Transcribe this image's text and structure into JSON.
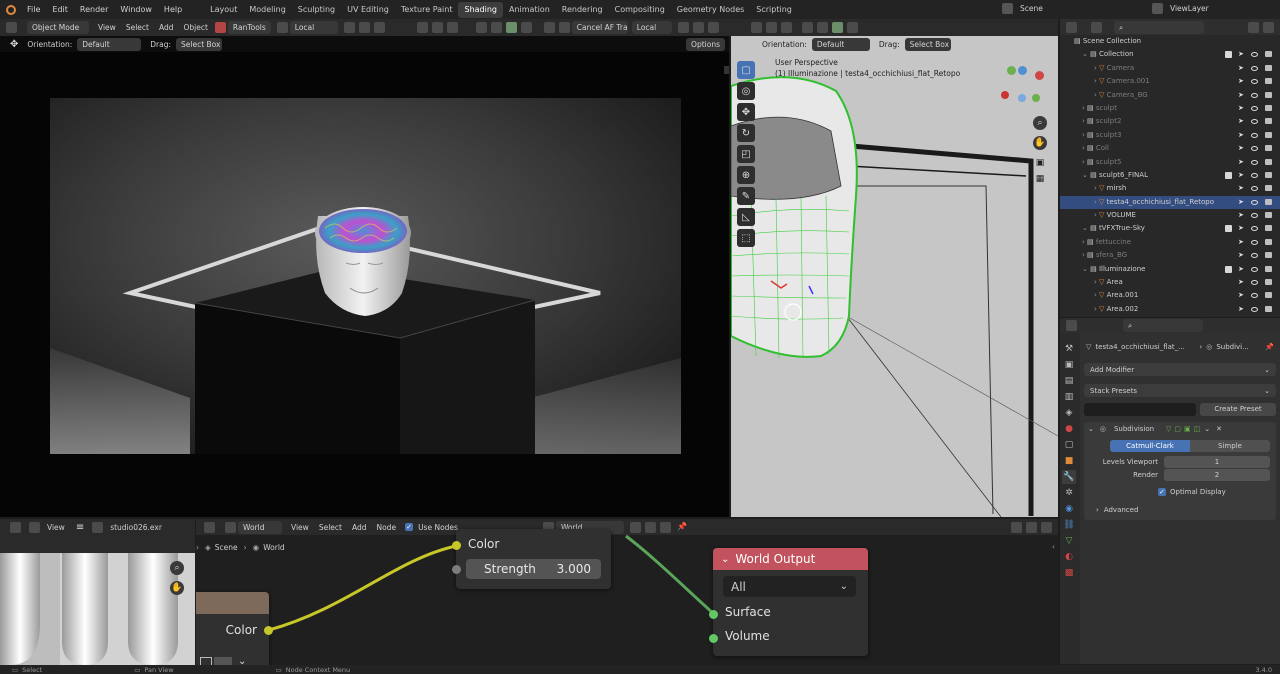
{
  "topbar": {
    "menu": [
      "File",
      "Edit",
      "Render",
      "Window",
      "Help"
    ],
    "workspaces": [
      "Layout",
      "Modeling",
      "Sculpting",
      "UV Editing",
      "Texture Paint",
      "Shading",
      "Animation",
      "Rendering",
      "Compositing",
      "Geometry Nodes",
      "Scripting"
    ],
    "active_workspace": "Shading",
    "scene": "Scene",
    "view_layer": "ViewLayer"
  },
  "viewport_header": {
    "mode": "Object Mode",
    "menus": [
      "View",
      "Select",
      "Add",
      "Object"
    ],
    "addon": "RanTools",
    "transform": "Local",
    "cancel_af": "Cancel AF Trac",
    "local_label": "Local"
  },
  "left_view": {
    "orientation_label": "Orientation:",
    "orientation_value": "Default",
    "drag_label": "Drag:",
    "drag_value": "Select Box",
    "options": "Options"
  },
  "right_view": {
    "orientation_label": "Orientation:",
    "orientation_value": "Default",
    "drag_label": "Drag:",
    "drag_value": "Select Box",
    "perspective": "User Perspective",
    "object_info": "(1) Illuminazione | testa4_occhichiusi_flat_Retopo"
  },
  "outliner": {
    "root": "Scene Collection",
    "items": [
      {
        "label": "Collection",
        "level": 1,
        "dim": false,
        "checked": true
      },
      {
        "label": "Camera",
        "level": 2,
        "dim": true
      },
      {
        "label": "Camera.001",
        "level": 2,
        "dim": true
      },
      {
        "label": "Camera_BG",
        "level": 2,
        "dim": true
      },
      {
        "label": "sculpt",
        "level": 1,
        "dim": true
      },
      {
        "label": "sculpt2",
        "level": 1,
        "dim": true
      },
      {
        "label": "sculpt3",
        "level": 1,
        "dim": true
      },
      {
        "label": "Coll",
        "level": 1,
        "dim": true
      },
      {
        "label": "sculpt5",
        "level": 1,
        "dim": true
      },
      {
        "label": "sculpt6_FINAL",
        "level": 1,
        "dim": false,
        "checked": true
      },
      {
        "label": "mirsh",
        "level": 2,
        "dim": false
      },
      {
        "label": "testa4_occhichiusi_flat_Retopo",
        "level": 2,
        "dim": false,
        "selected": true
      },
      {
        "label": "VOLUME",
        "level": 2,
        "dim": false
      },
      {
        "label": "tVFXTrue-Sky",
        "level": 1,
        "dim": false,
        "checked": true
      },
      {
        "label": "fettuccine",
        "level": 1,
        "dim": true
      },
      {
        "label": "sfera_BG",
        "level": 1,
        "dim": true
      },
      {
        "label": "Illuminazione",
        "level": 1,
        "dim": false,
        "checked": true
      },
      {
        "label": "Area",
        "level": 2,
        "dim": false
      },
      {
        "label": "Area.001",
        "level": 2,
        "dim": false
      },
      {
        "label": "Area.002",
        "level": 2,
        "dim": false
      }
    ]
  },
  "properties": {
    "breadcrumb_object": "testa4_occhichiusi_flat_...",
    "breadcrumb_modifier": "Subdivi...",
    "add_modifier": "Add Modifier",
    "stack_presets": "Stack Presets",
    "create_preset": "Create Preset",
    "modifier_name": "Subdivision",
    "tab_catmull": "Catmull-Clark",
    "tab_simple": "Simple",
    "levels_viewport_label": "Levels Viewport",
    "levels_viewport_value": "1",
    "render_label": "Render",
    "render_value": "2",
    "optimal_display": "Optimal Display",
    "advanced": "Advanced"
  },
  "image_editor": {
    "view": "View",
    "image_name": "studio026.exr"
  },
  "node_editor": {
    "type": "World",
    "menus": [
      "View",
      "Select",
      "Add",
      "Node"
    ],
    "use_nodes": "Use Nodes",
    "world_name": "World",
    "breadcrumb_scene": "Scene",
    "breadcrumb_world": "World",
    "bg_node": {
      "color_label": "Color",
      "strength_label": "Strength",
      "strength_value": "3.000"
    },
    "env_node": {
      "color_label": "Color"
    },
    "output_node": {
      "title": "World Output",
      "target": "All",
      "surface": "Surface",
      "volume": "Volume"
    }
  },
  "statusbar": {
    "select": "Select",
    "pan": "Pan View",
    "context": "Node Context Menu",
    "version": "3.4.0"
  },
  "colors": {
    "accent_blue": "#4772b3",
    "node_output_header": "#c2535e",
    "socket_yellow": "#c7c729",
    "socket_green": "#63c763",
    "wire_green": "#5aa55a"
  }
}
